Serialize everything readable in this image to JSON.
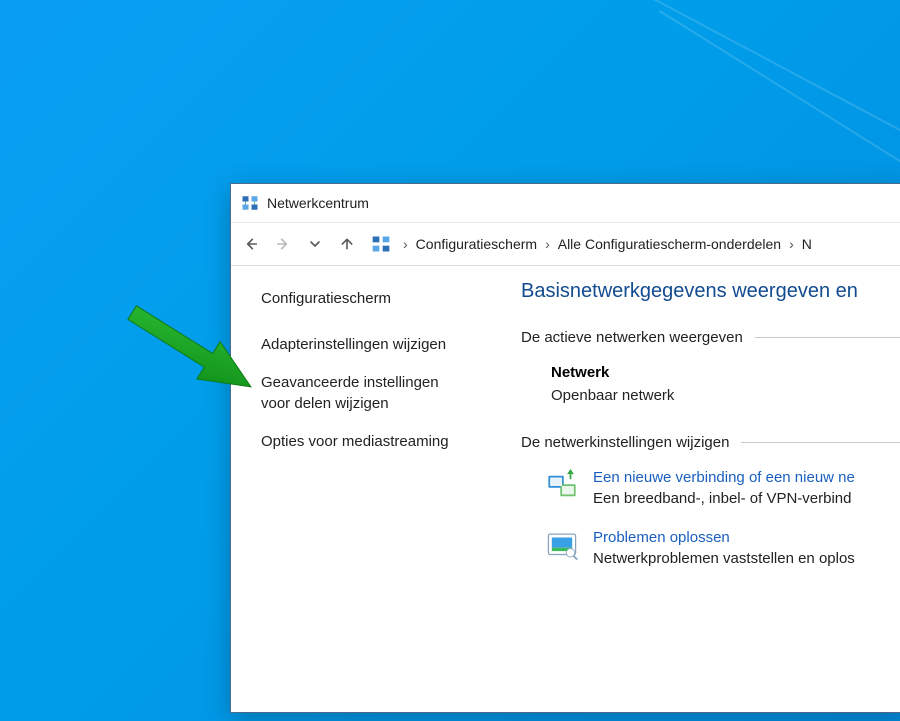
{
  "window": {
    "title": "Netwerkcentrum"
  },
  "breadcrumb": {
    "items": [
      "Configuratiescherm",
      "Alle Configuratiescherm-onderdelen",
      "N"
    ]
  },
  "sidebar": {
    "home": "Configuratiescherm",
    "links": [
      "Adapterinstellingen wijzigen",
      "Geavanceerde instellingen voor delen wijzigen",
      "Opties voor mediastreaming"
    ]
  },
  "content": {
    "heading": "Basisnetwerkgegevens weergeven en",
    "section_active": "De actieve netwerken weergeven",
    "network": {
      "name": "Netwerk",
      "type": "Openbaar netwerk"
    },
    "section_change": "De netwerkinstellingen wijzigen",
    "actions": [
      {
        "title": "Een nieuwe verbinding of een nieuw ne",
        "desc": "Een breedband-, inbel- of VPN-verbind"
      },
      {
        "title": "Problemen oplossen",
        "desc": "Netwerkproblemen vaststellen en oplos"
      }
    ]
  },
  "annotation": {
    "arrow_color": "#18a323"
  }
}
